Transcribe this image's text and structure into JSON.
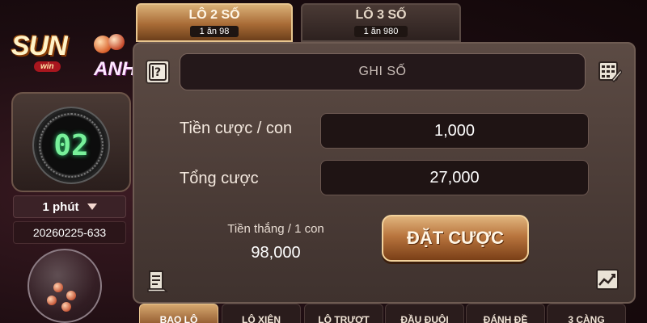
{
  "logo": {
    "line1": "SUN",
    "line2": "ANH",
    "badge": "win"
  },
  "timer": {
    "value": "02"
  },
  "period": {
    "label": "1 phút"
  },
  "round": {
    "id": "20260225-633"
  },
  "tabs": [
    {
      "label": "LÔ 2 SỐ",
      "odds": "1 ăn 98",
      "active": true
    },
    {
      "label": "LÔ 3 SỐ",
      "odds": "1 ăn 980",
      "active": false
    }
  ],
  "input": {
    "placeholder": "GHI SỐ"
  },
  "fields": {
    "stake_label": "Tiền cược / con",
    "stake_value": "1,000",
    "total_label": "Tổng cược",
    "total_value": "27,000"
  },
  "win": {
    "label": "Tiền thắng / 1 con",
    "value": "98,000"
  },
  "bet_button": {
    "label": "ĐẶT CƯỢC"
  },
  "bottom_tabs": [
    "BAO LÔ",
    "LÔ XIÊN",
    "LÔ TRƯỢT",
    "ĐẦU ĐUÔI",
    "ĐÁNH ĐỀ",
    "3 CÀNG"
  ],
  "colors": {
    "accent": "#c9874a",
    "timer": "#78f09a",
    "background": "#1a0d10"
  }
}
